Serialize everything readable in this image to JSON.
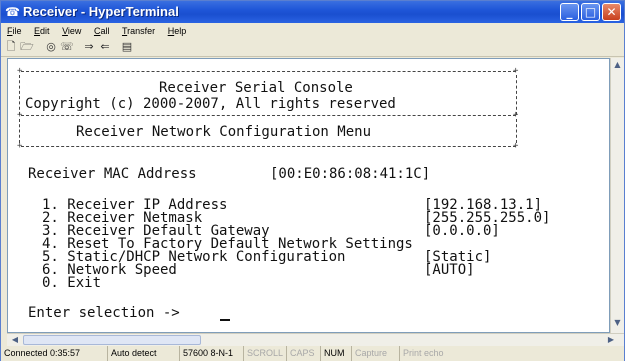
{
  "window": {
    "title": "Receiver - HyperTerminal",
    "controls": {
      "minimize": "_",
      "maximize": "□",
      "close": "✕"
    }
  },
  "menu": [
    {
      "accel": "F",
      "rest": "ile"
    },
    {
      "accel": "E",
      "rest": "dit"
    },
    {
      "accel": "V",
      "rest": "iew"
    },
    {
      "accel": "C",
      "rest": "all"
    },
    {
      "accel": "T",
      "rest": "ransfer"
    },
    {
      "accel": "H",
      "rest": "elp"
    }
  ],
  "toolbar_icons": [
    "new-icon",
    "open-icon",
    "disconnect-icon",
    "connect-icon",
    "send-icon",
    "receive-icon",
    "properties-icon"
  ],
  "terminal": {
    "header": {
      "line1": "Receiver Serial Console",
      "line2": "Copyright (c) 2000-2007, All rights reserved",
      "menu_title": "Receiver Network Configuration Menu"
    },
    "mac": {
      "label": "Receiver MAC Address",
      "value": "[00:E0:86:08:41:1C]"
    },
    "options": [
      {
        "label": "1. Receiver IP Address",
        "value": "[192.168.13.1]"
      },
      {
        "label": "2. Receiver Netmask",
        "value": "[255.255.255.0]"
      },
      {
        "label": "3. Receiver Default Gateway",
        "value": "[0.0.0.0]"
      },
      {
        "label": "4. Reset To Factory Default Network Settings",
        "value": ""
      },
      {
        "label": "5. Static/DHCP Network Configuration",
        "value": "[Static]"
      },
      {
        "label": "6. Network Speed",
        "value": "[AUTO]"
      },
      {
        "label": "0. Exit",
        "value": ""
      }
    ],
    "prompt": "Enter selection ->"
  },
  "status": {
    "connected": "Connected 0:35:57",
    "detect": "Auto detect",
    "settings": "57600 8-N-1",
    "scroll": "SCROLL",
    "caps": "CAPS",
    "num": "NUM",
    "capture": "Capture",
    "print_echo": "Print echo"
  }
}
